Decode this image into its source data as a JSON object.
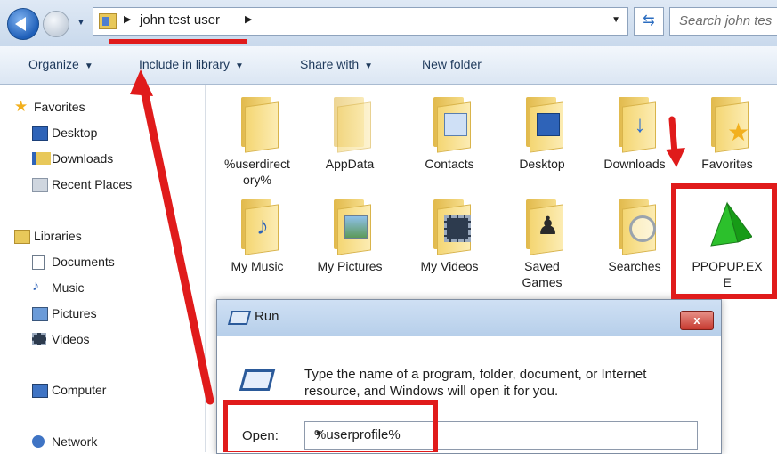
{
  "address_bar": {
    "breadcrumb": "john test user",
    "search_placeholder": "Search john tes"
  },
  "toolbar": {
    "items": [
      "Organize",
      "Include in library",
      "Share with",
      "New folder"
    ]
  },
  "nav": {
    "items": [
      "Favorites",
      "Desktop",
      "Downloads",
      "Recent Places",
      "Libraries",
      "Documents",
      "Music",
      "Pictures",
      "Videos",
      "Computer",
      "Network"
    ]
  },
  "folders": [
    {
      "label": "%userdirectory%",
      "label_line1": "%userdirect",
      "label_line2": "ory%"
    },
    {
      "label": "AppData"
    },
    {
      "label": "Contacts"
    },
    {
      "label": "Desktop"
    },
    {
      "label": "Downloads"
    },
    {
      "label": "Favorites"
    },
    {
      "label": "My Music"
    },
    {
      "label": "My Pictures"
    },
    {
      "label": "My Videos"
    },
    {
      "label": "Saved Games",
      "label_line1": "Saved",
      "label_line2": "Games"
    },
    {
      "label": "Searches"
    },
    {
      "label": "PPOPUP.EXE",
      "label_line1": "PPOPUP.EX",
      "label_line2": "E"
    }
  ],
  "run_dialog": {
    "title": "Run",
    "close": "x",
    "message": "Type the name of a program, folder, document, or Internet resource, and Windows will open it for you.",
    "open_label": "Open:",
    "open_value": "%userprofile%"
  },
  "colors": {
    "annotation_red": "#e01b1b",
    "toolbar_text": "#1e395b",
    "folder_yellow": "#f4d673",
    "exe_green": "#2cc02c"
  }
}
